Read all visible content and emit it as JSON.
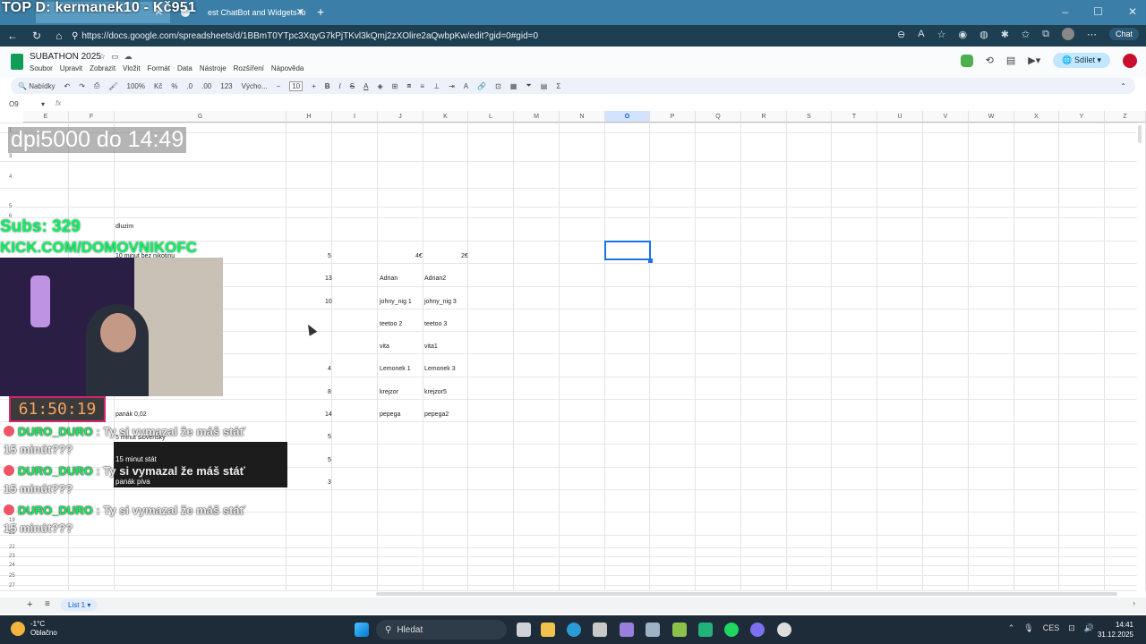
{
  "browser": {
    "tabs": [
      {
        "label": "",
        "active": true
      },
      {
        "label": "est ChatBot and Widgets fo",
        "active": false
      }
    ],
    "url": "https://docs.google.com/spreadsheets/d/1BBmT0YTpc3XqyG7kPjTKvl3kQmj2zXOlire2aQwbpKw/edit?gid=0#gid=0",
    "chat_label": "Chat"
  },
  "overlay": {
    "top_donor": "TOP D: kermanek10 - Kč951",
    "stream_title": "dpi5000 do 14:49",
    "subs": "Subs: 329",
    "kick": "KICK.COM/DOMOVNIKOFC",
    "timer": "61:50:19",
    "chat": [
      {
        "user": "DURO_DURO",
        "sep": ":",
        "text": "Ty si vymazal že máš stáť",
        "text2": "15 minút???"
      },
      {
        "user": "DURO_DURO",
        "sep": ":",
        "text": "Ty si vymazal že máš stáť",
        "text2": "15 minút???"
      },
      {
        "user": "DURO_DURO",
        "sep": ":",
        "text": "Ty si vymazal že máš stáť",
        "text2": "15 minút???"
      }
    ]
  },
  "sheets": {
    "doc_title": "SUBATHON 2025",
    "menu": [
      "Soubor",
      "Upravit",
      "Zobrazit",
      "Vložit",
      "Formát",
      "Data",
      "Nástroje",
      "Rozšíření",
      "Nápověda"
    ],
    "share_label": "Sdílet",
    "toolbar": {
      "search": "Nabídky",
      "zoom": "100%",
      "currency": "Kč",
      "percent": "%",
      "decimals": ".0",
      "decimals2": ".00",
      "number_format": "123",
      "font": "Výcho...",
      "font_size": "10"
    },
    "cell_ref": "O9",
    "fx": "fx",
    "columns": [
      "E",
      "F",
      "G",
      "H",
      "I",
      "J",
      "K",
      "L",
      "M",
      "N",
      "O",
      "P",
      "Q",
      "R",
      "S",
      "T",
      "U",
      "V",
      "W",
      "X",
      "Y",
      "Z"
    ],
    "row_numbers": [
      "1",
      "3",
      "4",
      "5",
      "6",
      "19",
      "20",
      "21",
      "22",
      "23",
      "24",
      "25",
      "26",
      "27"
    ],
    "cells": {
      "dluzim": "dluzim",
      "min_bez": "10 minut bez nikotinu",
      "panak": "panák 0,02",
      "slovensky": "5 minut slovensky",
      "minut_stat": "15 minut stát",
      "panak_piva": "panák piva",
      "h_values": [
        "5",
        "13",
        "10",
        "4",
        "8",
        "14",
        "5",
        "5",
        "3"
      ],
      "j_header": "4€",
      "k_header": "2€",
      "j_values": [
        "Adrian",
        "johny_nig 1",
        "teetoo 2",
        "vita",
        "Lemonek 1",
        "krejzor",
        "pepega"
      ],
      "k_values": [
        "Adrian2",
        "johny_nig 3",
        "teetoo 3",
        "vita1",
        "Lemonek 3",
        "krejzor5",
        "pepega2"
      ]
    },
    "sheet_tab": "List 1"
  },
  "taskbar": {
    "temp": "-1°C",
    "weather": "Oblačno",
    "search": "Hledat",
    "lang": "CES",
    "time": "14:41",
    "date": "31.12.2025"
  }
}
